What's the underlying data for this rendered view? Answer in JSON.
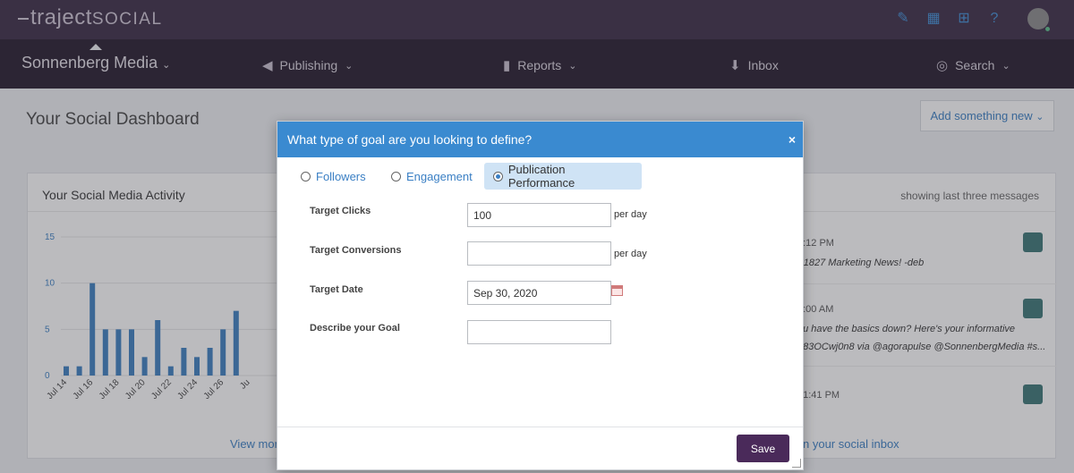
{
  "topbar": {
    "logo_main": "traject",
    "logo_sub": "SOCIAL",
    "icons": [
      "edit-icon",
      "calendar-icon",
      "add-box-icon",
      "help-icon"
    ]
  },
  "nav": {
    "brand": "Sonnenberg Media",
    "items": [
      {
        "label": "Publishing",
        "icon": "megaphone-icon"
      },
      {
        "label": "Reports",
        "icon": "bar-chart-icon"
      },
      {
        "label": "Inbox",
        "icon": "inbox-icon"
      },
      {
        "label": "Search",
        "icon": "search-target-icon"
      }
    ]
  },
  "dashboard": {
    "title": "Your Social Dashboard",
    "add_button": "Add something new",
    "activity_title": "Your Social Media Activity",
    "view_more": "View mor",
    "inbox_note": "showing last three messages",
    "inbox_link": "n your social inbox",
    "messages": [
      {
        "time": "3:12 PM",
        "text": "- 1827 Marketing News! -deb"
      },
      {
        "time": "0:00 AM",
        "text": "ou have the basics down? Here's your informative"
      },
      {
        "time": "",
        "text": "483OCwj0n8 via @agorapulse @SonnenbergMedia #s..."
      },
      {
        "time": ", 1:41 PM",
        "text": ""
      }
    ]
  },
  "chart_data": {
    "type": "bar",
    "categories": [
      "Jul 14",
      "",
      "Jul 16",
      "",
      "Jul 18",
      "",
      "Jul 20",
      "",
      "Jul 22",
      "",
      "Jul 24",
      "",
      "Jul 26",
      "",
      "Ju"
    ],
    "tick_labels": [
      "Jul 14",
      "Jul 16",
      "Jul 18",
      "Jul 20",
      "Jul 22",
      "Jul 24",
      "Jul 26",
      "Ju"
    ],
    "values": [
      1,
      1,
      10,
      5,
      5,
      5,
      2,
      6,
      1,
      3,
      2,
      3,
      5,
      7
    ],
    "yticks": [
      0,
      5,
      10,
      15
    ],
    "ylim": [
      0,
      15
    ],
    "color": "#3b7fc0"
  },
  "modal": {
    "title": "What type of goal are you looking to define?",
    "close": "×",
    "options": [
      {
        "label": "Followers",
        "checked": false
      },
      {
        "label": "Engagement",
        "checked": false
      },
      {
        "label": "Publication Performance",
        "checked": true
      }
    ],
    "fields": [
      {
        "label": "Target Clicks",
        "value": "100",
        "unit": "per day"
      },
      {
        "label": "Target Conversions",
        "value": "",
        "unit": "per day"
      },
      {
        "label": "Target Date",
        "value": "Sep 30, 2020",
        "unit": ""
      },
      {
        "label": "Describe your Goal",
        "value": "",
        "unit": ""
      }
    ],
    "save": "Save"
  },
  "colors": {
    "topbar": "#3a2a44",
    "navbar": "#241a2c",
    "modal_header": "#3a8ad0",
    "save_button": "#4a2a5a",
    "accent": "#3a7fc4"
  }
}
